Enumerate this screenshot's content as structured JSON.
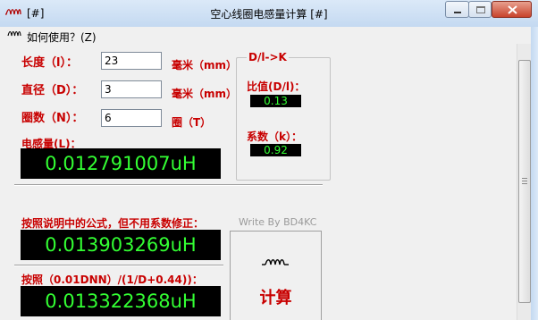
{
  "window": {
    "title": "空心线圈电感量计算 [#]",
    "tag": "[#]"
  },
  "menu": {
    "help": "如何使用？(Z)"
  },
  "form": {
    "length_label": "长度（l）：",
    "length_value": "23",
    "diameter_label": "直径（D）：",
    "diameter_value": "3",
    "turns_label": "圈数（N）：",
    "turns_value": "6",
    "unit_mm": "毫米（mm）",
    "unit_turns": "圈（T）"
  },
  "ratio_group": {
    "title": "D/l->K",
    "ratio_label": "比值(D/l)：",
    "ratio_value": "0.13",
    "coef_label": "系数（k）：",
    "coef_value": "0.92"
  },
  "results": {
    "inductance_label": "电感量(L)：",
    "inductance_value": "0.012791007uH",
    "formula_label": "按照说明中的公式，但不用系数修正：",
    "formula_value": "0.013903269uH",
    "alt_label": "按照（0.01DNN）/(1/D+0.44))：",
    "alt_value": "0.013322368uH"
  },
  "credit": "Write By BD4KC",
  "calc_button": {
    "label": "计算",
    "icon": "coil-icon"
  },
  "colors": {
    "label_red": "#c80000",
    "lcd_green": "#33ff33",
    "lcd_bg": "#000000"
  }
}
